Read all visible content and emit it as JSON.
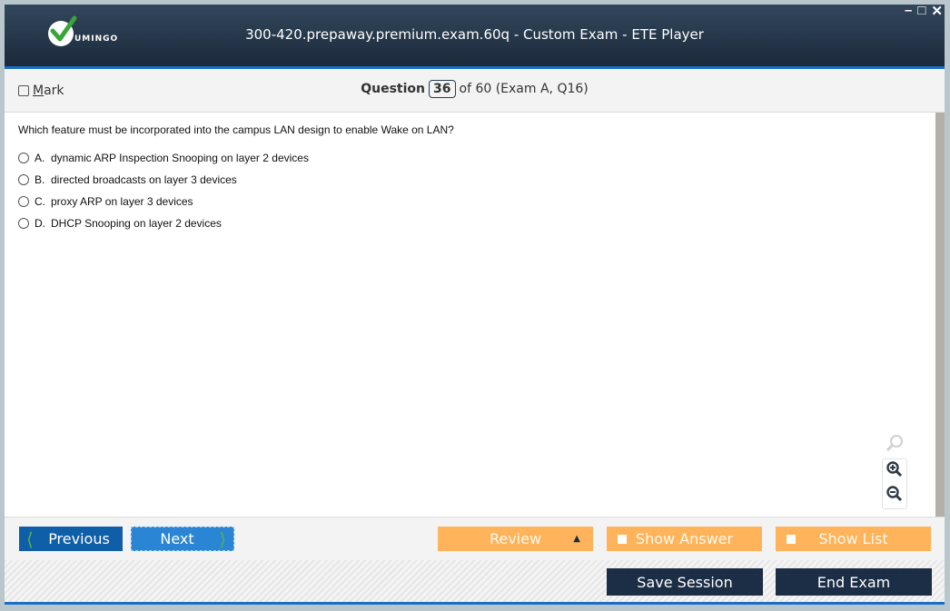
{
  "window": {
    "brand": "UMINGO",
    "title": "300-420.prepaway.premium.exam.60q - Custom Exam - ETE Player",
    "controls": {
      "minimize": "minimize-icon",
      "maximize": "maximize-icon",
      "close": "close-icon"
    }
  },
  "header": {
    "mark_label_underlined": "M",
    "mark_label_rest": "ark",
    "question_label": "Question",
    "question_number": "36",
    "question_suffix": "of 60 (Exam A, Q16)"
  },
  "question": {
    "text": "Which feature must be incorporated into the campus LAN design to enable Wake on LAN?",
    "options": [
      {
        "letter": "A.",
        "text": "dynamic ARP Inspection Snooping on layer 2 devices"
      },
      {
        "letter": "B.",
        "text": "directed broadcasts on layer 3 devices"
      },
      {
        "letter": "C.",
        "text": "proxy ARP on layer 3 devices"
      },
      {
        "letter": "D.",
        "text": "DHCP Snooping on layer 2 devices"
      }
    ]
  },
  "nav": {
    "previous": "Previous",
    "next": "Next",
    "review": "Review",
    "show_answer": "Show Answer",
    "show_list": "Show List"
  },
  "footer": {
    "save_session": "Save Session",
    "end_exam": "End Exam"
  },
  "colors": {
    "accent_blue": "#1a6fc4",
    "orange": "#ffb35a",
    "dark_navy": "#1b2e45"
  }
}
